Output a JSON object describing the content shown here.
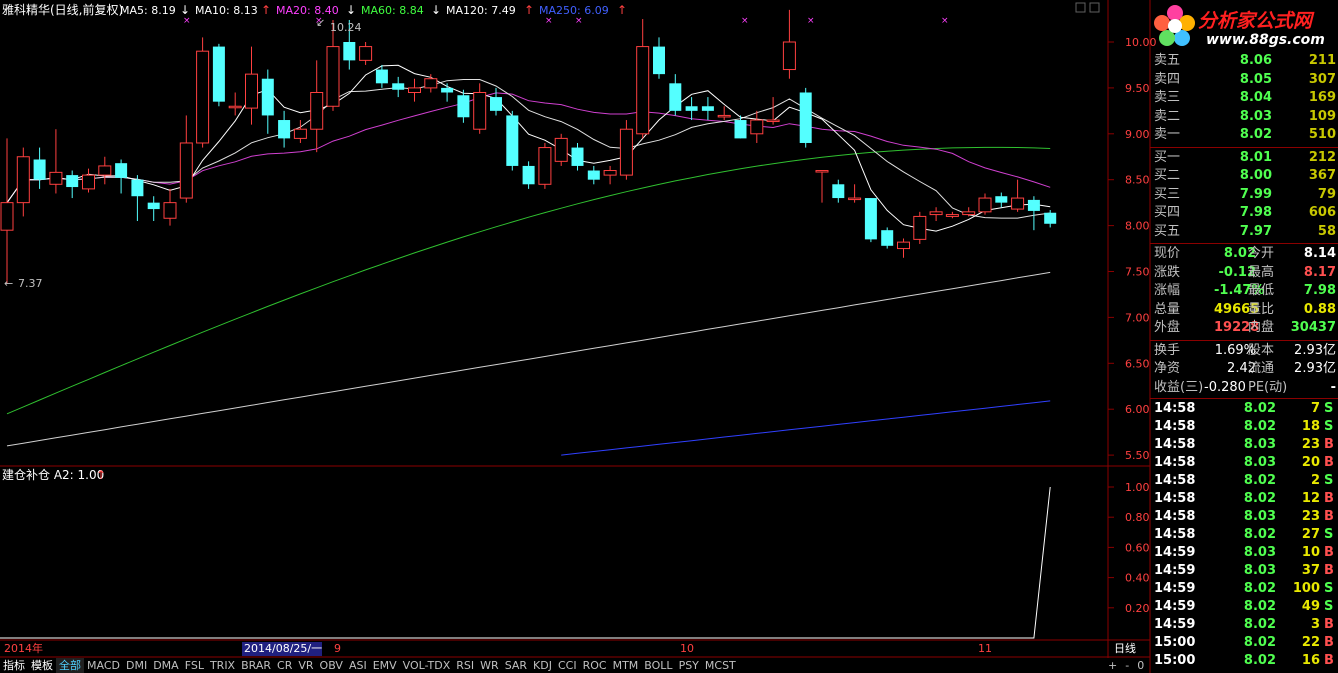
{
  "header": {
    "stock_title": "雅科精华(日线,前复权)",
    "ma_items": [
      {
        "label": "MA5: 8.19",
        "arrow": "↓",
        "color": "#ffffff"
      },
      {
        "label": "MA10: 8.13",
        "arrow": "↑",
        "color": "#ffffff"
      },
      {
        "label": "MA20: 8.40",
        "arrow": "↓",
        "color": "#ff40ff"
      },
      {
        "label": "MA60: 8.84",
        "arrow": "↓",
        "color": "#40ff40"
      },
      {
        "label": "MA120: 7.49",
        "arrow": "↑",
        "color": "#ffffff"
      },
      {
        "label": "MA250: 6.09",
        "arrow": "↑",
        "color": "#4060ff"
      }
    ]
  },
  "indicator_header": {
    "label": "建仓补仓 A2: 1.00",
    "arrow": "↑"
  },
  "annotations": {
    "high": "10.24",
    "low": "7.37"
  },
  "price_axis": [
    "10.00",
    "9.50",
    "9.00",
    "8.50",
    "8.00",
    "7.50",
    "7.00",
    "6.50",
    "6.00",
    "5.50"
  ],
  "indicator_axis": [
    "1.00",
    "0.80",
    "0.60",
    "0.40",
    "0.20"
  ],
  "date_axis": {
    "year": "2014年",
    "cursor_date": "2014/08/25/一",
    "months": [
      "9",
      "10",
      "11"
    ],
    "period": "日线"
  },
  "logo": {
    "name": "分析家公式网",
    "url": "www.88gs.com"
  },
  "order_book": {
    "sell": [
      {
        "label": "卖五",
        "price": "8.06",
        "vol": "211"
      },
      {
        "label": "卖四",
        "price": "8.05",
        "vol": "307"
      },
      {
        "label": "卖三",
        "price": "8.04",
        "vol": "169"
      },
      {
        "label": "卖二",
        "price": "8.03",
        "vol": "109"
      },
      {
        "label": "卖一",
        "price": "8.02",
        "vol": "510"
      }
    ],
    "buy": [
      {
        "label": "买一",
        "price": "8.01",
        "vol": "212"
      },
      {
        "label": "买二",
        "price": "8.00",
        "vol": "367"
      },
      {
        "label": "买三",
        "price": "7.99",
        "vol": "79"
      },
      {
        "label": "买四",
        "price": "7.98",
        "vol": "606"
      },
      {
        "label": "买五",
        "price": "7.97",
        "vol": "58"
      }
    ]
  },
  "stats": [
    {
      "l1": "现价",
      "v1": "8.02",
      "c1": "green",
      "l2": "今开",
      "v2": "8.14",
      "c2": "white"
    },
    {
      "l1": "涨跌",
      "v1": "-0.12",
      "c1": "green",
      "l2": "最高",
      "v2": "8.17",
      "c2": "red"
    },
    {
      "l1": "涨幅",
      "v1": "-1.47%",
      "c1": "green",
      "l2": "最低",
      "v2": "7.98",
      "c2": "green"
    },
    {
      "l1": "总量",
      "v1": "49665",
      "c1": "yellow",
      "l2": "量比",
      "v2": "0.88",
      "c2": "yellow"
    },
    {
      "l1": "外盘",
      "v1": "19228",
      "c1": "red",
      "l2": "内盘",
      "v2": "30437",
      "c2": "green"
    }
  ],
  "stats2": [
    {
      "l1": "换手",
      "v1": "1.69%",
      "l2": "股本",
      "v2": "2.93亿"
    },
    {
      "l1": "净资",
      "v1": "2.42",
      "l2": "流通",
      "v2": "2.93亿"
    }
  ],
  "eps": {
    "l1": "收益(三)",
    "v1": "-0.280",
    "l2": "PE(动)",
    "v2": "-"
  },
  "ticks": [
    {
      "time": "14:58",
      "price": "8.02",
      "vol": "7",
      "bs": "S"
    },
    {
      "time": "14:58",
      "price": "8.02",
      "vol": "18",
      "bs": "S"
    },
    {
      "time": "14:58",
      "price": "8.03",
      "vol": "23",
      "bs": "B"
    },
    {
      "time": "14:58",
      "price": "8.03",
      "vol": "20",
      "bs": "B"
    },
    {
      "time": "14:58",
      "price": "8.02",
      "vol": "2",
      "bs": "S"
    },
    {
      "time": "14:58",
      "price": "8.02",
      "vol": "12",
      "bs": "B"
    },
    {
      "time": "14:58",
      "price": "8.03",
      "vol": "23",
      "bs": "B"
    },
    {
      "time": "14:58",
      "price": "8.02",
      "vol": "27",
      "bs": "S"
    },
    {
      "time": "14:59",
      "price": "8.03",
      "vol": "10",
      "bs": "B"
    },
    {
      "time": "14:59",
      "price": "8.03",
      "vol": "37",
      "bs": "B"
    },
    {
      "time": "14:59",
      "price": "8.02",
      "vol": "100",
      "bs": "S"
    },
    {
      "time": "14:59",
      "price": "8.02",
      "vol": "49",
      "bs": "S"
    },
    {
      "time": "14:59",
      "price": "8.02",
      "vol": "3",
      "bs": "B"
    },
    {
      "time": "15:00",
      "price": "8.02",
      "vol": "22",
      "bs": "B"
    },
    {
      "time": "15:00",
      "price": "8.02",
      "vol": "16",
      "bs": "B"
    }
  ],
  "tabs": [
    "指标",
    "模板",
    "全部",
    "MACD",
    "DMI",
    "DMA",
    "FSL",
    "TRIX",
    "BRAR",
    "CR",
    "VR",
    "OBV",
    "ASI",
    "EMV",
    "VOL-TDX",
    "RSI",
    "WR",
    "SAR",
    "KDJ",
    "CCI",
    "ROC",
    "MTM",
    "BOLL",
    "PSY",
    "MCST"
  ],
  "tabs_right": [
    "+",
    "-",
    "0"
  ],
  "colors": {
    "up": "#ff4040",
    "down": "#54ffff",
    "ma5": "#ffffff",
    "ma10": "#e0e0e0",
    "ma20": "#d040d0",
    "ma60": "#30c030",
    "ma120": "#d0d0d0",
    "ma250": "#3040ff",
    "grid_red": "#8b0000"
  },
  "chart_data": {
    "type": "candlestick",
    "price_range": [
      5.4,
      10.35
    ],
    "candles": [
      [
        7.95,
        8.25,
        8.95,
        7.37
      ],
      [
        8.25,
        8.75,
        8.85,
        8.1
      ],
      [
        8.72,
        8.5,
        8.85,
        8.4
      ],
      [
        8.45,
        8.58,
        9.05,
        8.35
      ],
      [
        8.55,
        8.42,
        8.6,
        8.3
      ],
      [
        8.4,
        8.55,
        8.62,
        8.36
      ],
      [
        8.55,
        8.65,
        8.75,
        8.45
      ],
      [
        8.68,
        8.52,
        8.72,
        8.35
      ],
      [
        8.5,
        8.32,
        8.55,
        8.05
      ],
      [
        8.25,
        8.18,
        8.32,
        8.05
      ],
      [
        8.08,
        8.25,
        8.4,
        8.0
      ],
      [
        8.3,
        8.9,
        9.2,
        8.25
      ],
      [
        8.9,
        9.9,
        10.05,
        8.85
      ],
      [
        9.95,
        9.35,
        9.98,
        9.3
      ],
      [
        9.3,
        9.3,
        9.45,
        9.2
      ],
      [
        9.28,
        9.65,
        9.95,
        9.1
      ],
      [
        9.6,
        9.2,
        9.7,
        9.0
      ],
      [
        9.15,
        8.95,
        9.25,
        8.85
      ],
      [
        8.95,
        9.05,
        9.15,
        8.9
      ],
      [
        9.05,
        9.45,
        9.8,
        8.8
      ],
      [
        9.3,
        9.95,
        10.24,
        9.25
      ],
      [
        10.0,
        9.8,
        10.24,
        9.7
      ],
      [
        9.8,
        9.95,
        10.0,
        9.75
      ],
      [
        9.7,
        9.55,
        9.75,
        9.5
      ],
      [
        9.55,
        9.48,
        9.62,
        9.4
      ],
      [
        9.45,
        9.5,
        9.6,
        9.35
      ],
      [
        9.5,
        9.6,
        9.65,
        9.45
      ],
      [
        9.5,
        9.45,
        9.55,
        9.35
      ],
      [
        9.42,
        9.18,
        9.48,
        9.12
      ],
      [
        9.05,
        9.45,
        9.55,
        9.0
      ],
      [
        9.4,
        9.25,
        9.5,
        9.2
      ],
      [
        9.2,
        8.65,
        9.25,
        8.6
      ],
      [
        8.65,
        8.45,
        8.7,
        8.4
      ],
      [
        8.45,
        8.85,
        8.9,
        8.4
      ],
      [
        8.7,
        8.95,
        9.0,
        8.65
      ],
      [
        8.85,
        8.65,
        8.9,
        8.6
      ],
      [
        8.6,
        8.5,
        8.65,
        8.45
      ],
      [
        8.55,
        8.6,
        8.65,
        8.45
      ],
      [
        8.55,
        9.05,
        9.15,
        8.5
      ],
      [
        9.0,
        9.95,
        10.25,
        8.95
      ],
      [
        9.95,
        9.65,
        10.05,
        9.6
      ],
      [
        9.55,
        9.25,
        9.65,
        9.2
      ],
      [
        9.3,
        9.25,
        9.4,
        9.15
      ],
      [
        9.3,
        9.25,
        9.4,
        9.15
      ],
      [
        9.2,
        9.2,
        9.3,
        9.15
      ],
      [
        9.15,
        8.95,
        9.2,
        8.95
      ],
      [
        9.0,
        9.15,
        9.25,
        8.9
      ],
      [
        9.15,
        9.15,
        9.4,
        9.1
      ],
      [
        9.7,
        10.0,
        10.35,
        9.6
      ],
      [
        9.45,
        8.9,
        9.5,
        8.85
      ],
      [
        8.6,
        8.6,
        8.6,
        8.25
      ],
      [
        8.45,
        8.3,
        8.5,
        8.25
      ],
      [
        8.3,
        8.3,
        8.45,
        8.25
      ],
      [
        8.3,
        7.85,
        8.3,
        7.82
      ],
      [
        7.95,
        7.78,
        7.98,
        7.75
      ],
      [
        7.75,
        7.82,
        7.86,
        7.65
      ],
      [
        7.85,
        8.1,
        8.15,
        7.8
      ],
      [
        8.12,
        8.15,
        8.2,
        8.05
      ],
      [
        8.1,
        8.12,
        8.15,
        8.08
      ],
      [
        8.12,
        8.15,
        8.2,
        8.1
      ],
      [
        8.15,
        8.3,
        8.35,
        8.12
      ],
      [
        8.32,
        8.25,
        8.36,
        8.2
      ],
      [
        8.18,
        8.3,
        8.5,
        8.15
      ],
      [
        8.28,
        8.16,
        8.32,
        7.95
      ],
      [
        8.14,
        8.02,
        8.17,
        7.98
      ]
    ],
    "ma120": [
      5.6,
      7.49
    ],
    "ma250": [
      5.5,
      6.09
    ],
    "indicator_A2": {
      "value": 1.0,
      "range": [
        0,
        1.05
      ]
    }
  }
}
